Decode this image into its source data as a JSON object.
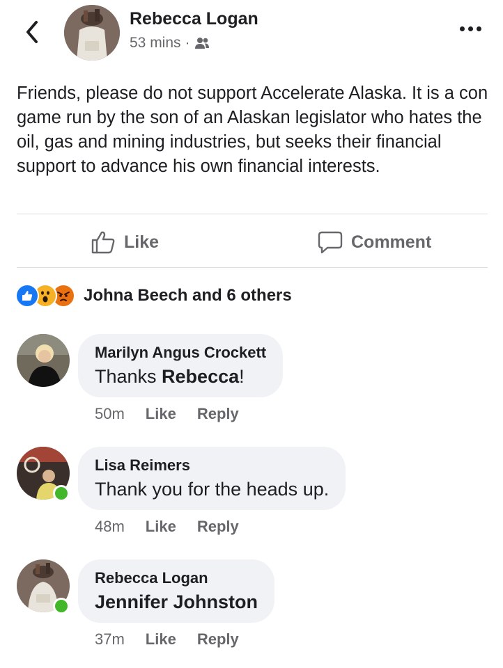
{
  "header": {
    "author": "Rebecca Logan",
    "time": "53 mins",
    "separator": "·",
    "audience_icon": "friends-icon",
    "back_icon": "chevron-left-icon",
    "more_icon": "more-dots-icon"
  },
  "post": {
    "text": "Friends, please do not support Accelerate Alaska.  It is a con game run by the son of an Alaskan legislator who hates the oil, gas and mining industries, but seeks their financial support to advance his own financial interests."
  },
  "actions": {
    "like_label": "Like",
    "comment_label": "Comment"
  },
  "reactions": {
    "icons": [
      "like-reaction-icon",
      "wow-reaction-icon",
      "angry-reaction-icon"
    ],
    "summary": "Johna Beech and 6 others",
    "colors": {
      "like": "#1877f2",
      "wow": "#f7b125",
      "angry": "#e9710f"
    }
  },
  "comments": [
    {
      "name": "Marilyn Angus Crockett",
      "text_prefix": "Thanks ",
      "text_bold": "Rebecca",
      "text_suffix": "!",
      "time": "50m",
      "like": "Like",
      "reply": "Reply",
      "online": false
    },
    {
      "name": "Lisa Reimers",
      "text": "Thank you for the heads up.",
      "time": "48m",
      "like": "Like",
      "reply": "Reply",
      "online": true
    },
    {
      "name": "Rebecca Logan",
      "text_bold": "Jennifer Johnston",
      "time": "37m",
      "like": "Like",
      "reply": "Reply",
      "online": true
    }
  ],
  "colors": {
    "text_primary": "#1c1e21",
    "text_secondary": "#65676b",
    "bubble_bg": "#f0f2f5",
    "online_green": "#42b72a"
  }
}
